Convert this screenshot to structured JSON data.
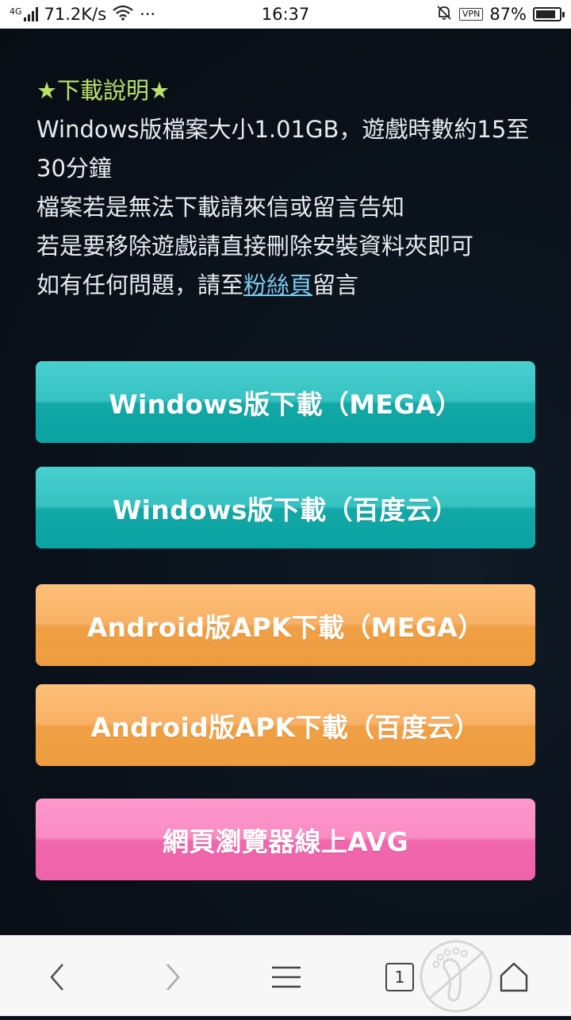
{
  "status_bar": {
    "network_type": "4G",
    "speed": "71.2K/s",
    "more": "···",
    "time": "16:37",
    "vpn": "VPN",
    "battery_text": "87%",
    "battery_level": 0.87,
    "icons": [
      "signal-icon",
      "wifi-icon",
      "mute-bell-icon",
      "vpn-icon",
      "battery-icon"
    ]
  },
  "info": {
    "title": "★下載說明★",
    "line1": "Windows版檔案大小1.01GB，遊戲時數約15至30分鐘",
    "line2": "檔案若是無法下載請來信或留言告知",
    "line3": "若是要移除遊戲請直接刪除安裝資料夾即可",
    "line4_prefix": "如有任何問題，請至",
    "line4_link": "粉絲頁",
    "line4_suffix": "留言"
  },
  "buttons": {
    "win_mega": "Windows版下載（MEGA）",
    "win_baidu": "Windows版下載（百度云）",
    "android_mega": "Android版APK下載（MEGA）",
    "android_baidu": "Android版APK下載（百度云）",
    "web_avg": "網頁瀏覽器線上AVG"
  },
  "colors": {
    "teal": "#0aa3a1",
    "orange": "#ee9c3f",
    "pink": "#ee62aa",
    "title_green": "#b9e26a",
    "link_blue": "#7cc6ea"
  },
  "bottom_bar": {
    "tab_count": "1",
    "icons": [
      "back-icon",
      "forward-icon",
      "menu-icon",
      "tabs-icon",
      "incognito-icon",
      "home-icon"
    ]
  }
}
